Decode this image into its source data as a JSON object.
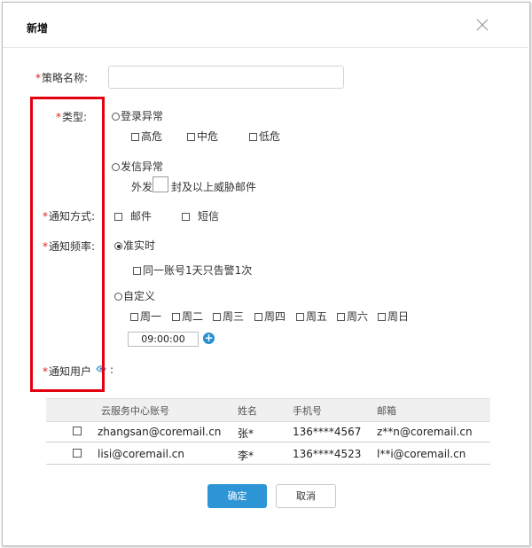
{
  "dialog": {
    "title": "新增",
    "required_mark": "*"
  },
  "form": {
    "policy_name_label": "策略名称:",
    "policy_name_value": "",
    "type_label": "类型:",
    "login_anomaly": "登录异常",
    "level_high": "高危",
    "level_mid": "中危",
    "level_low": "低危",
    "send_anomaly": "发信异常",
    "send_prefix": "外发",
    "send_suffix": "封及以上威胁邮件",
    "notify_method_label": "通知方式:",
    "method_email": "邮件",
    "method_sms": "短信",
    "notify_freq_label": "通知频率:",
    "realtime": "准实时",
    "once_per_day": "同一账号1天只告警1次",
    "custom": "自定义",
    "weekdays": [
      "周一",
      "周二",
      "周三",
      "周四",
      "周五",
      "周六",
      "周日"
    ],
    "time_value": "09:00:00",
    "add_symbol": "+",
    "notify_user_label": "通知用户",
    "notify_user_colon": ":"
  },
  "table": {
    "headers": [
      "云服务中心账号",
      "姓名",
      "手机号",
      "邮箱"
    ],
    "rows": [
      [
        "zhangsan@coremail.cn",
        "张*",
        "136****4567",
        "z**n@coremail.cn"
      ],
      [
        "lisi@coremail.cn",
        "李*",
        "136****4523",
        "l**i@coremail.cn"
      ]
    ]
  },
  "buttons": {
    "confirm": "确定",
    "cancel": "取消"
  },
  "colors": {
    "required": "#e02020",
    "primary": "#2d94d6",
    "highlight_box": "#e3000f"
  }
}
